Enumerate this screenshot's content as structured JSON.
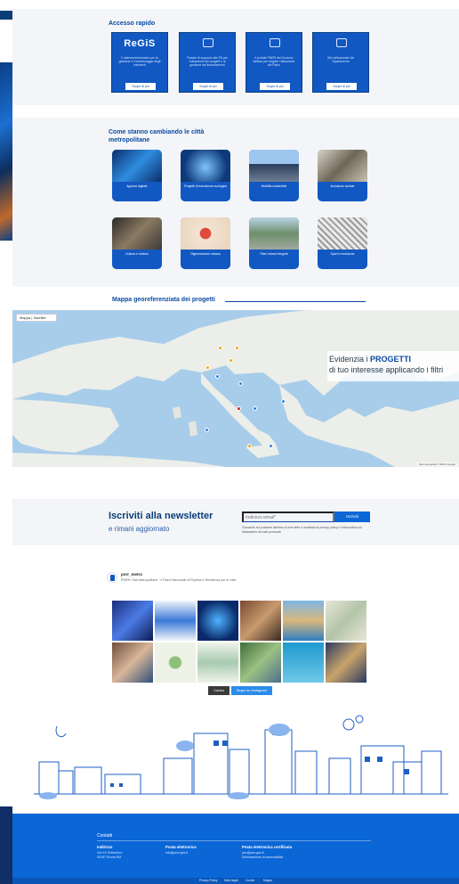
{
  "quick_access": {
    "title": "Accesso rapido",
    "cards": [
      {
        "logo": "ReGiS",
        "desc": "Il sistema informativo per la gestione e il monitoraggio degli interventi",
        "button": "Scopri di più"
      },
      {
        "logo": "",
        "desc": "Portale di supporto alle PA per l'attuazione dei progetti e la gestione dei finanziamenti",
        "button": "Scopri di più"
      },
      {
        "logo": "",
        "desc": "Il portale PNRR del Governo italiano per seguire l'attuazione del Piano",
        "button": "Scopri di più"
      },
      {
        "logo": "",
        "desc": "Sito istituzionale del Dipartimento",
        "button": "Scopri di più"
      }
    ]
  },
  "cities": {
    "title": "Come stanno cambiando le città metropolitane",
    "cards": [
      {
        "label": "Agenda digitale"
      },
      {
        "label": "Progetti di transizione ecologica"
      },
      {
        "label": "Mobilità sostenibile"
      },
      {
        "label": "Inclusione sociale"
      },
      {
        "label": "Cultura e turismo"
      },
      {
        "label": "Rigenerazione urbana"
      },
      {
        "label": "Piani urbani integrati"
      },
      {
        "label": "Sport e inclusione"
      }
    ]
  },
  "map": {
    "title": "Mappa georeferenziata dei progetti",
    "controls": "Mappa | Satellite",
    "overlay_line1_prefix": "Evidenzia i",
    "overlay_line1_bold": "PROGETTI",
    "overlay_line2": "di tuo interesse applicando i filtri",
    "attribution": "Dati cartografici ©2024 Google"
  },
  "newsletter": {
    "title": "Iscriviti alla newsletter",
    "subtitle": "e rimani aggiornato",
    "placeholder": "Indirizzo email*",
    "button": "Iscriviti",
    "note": "Cliccando sul pulsante dichiaro di aver letto e accettato la privacy policy e l'informativa sul trattamento dei dati personali"
  },
  "instagram": {
    "name": "pnrr_metro",
    "bio": "PNRR Città Metropolitane · Il Piano Nazionale di Ripresa e Resilienza per le città",
    "btn_load": "Carica",
    "btn_follow": "Segui su Instagram"
  },
  "footer": {
    "heading": "Contatti",
    "col1_title": "Indirizzo",
    "col1_items": [
      "Via XX Settembre",
      "00187 Roma RM"
    ],
    "col2_title": "Posta elettronica",
    "col2_items": [
      "info@pnrr.gov.it"
    ],
    "col3_title": "Posta elettronica certificata",
    "col3_items": [
      "pec@pec.gov.it",
      "Dichiarazione di accessibilità"
    ],
    "bottom_links": [
      "Privacy Policy",
      "Note legali",
      "Cookie",
      "Mappa"
    ]
  },
  "colors": {
    "brand_blue": "#0b66d6",
    "dark_blue": "#0b3d78",
    "pin_orange": "#f2a516",
    "pin_blue": "#2f7de1",
    "pin_red": "#d8272a"
  }
}
